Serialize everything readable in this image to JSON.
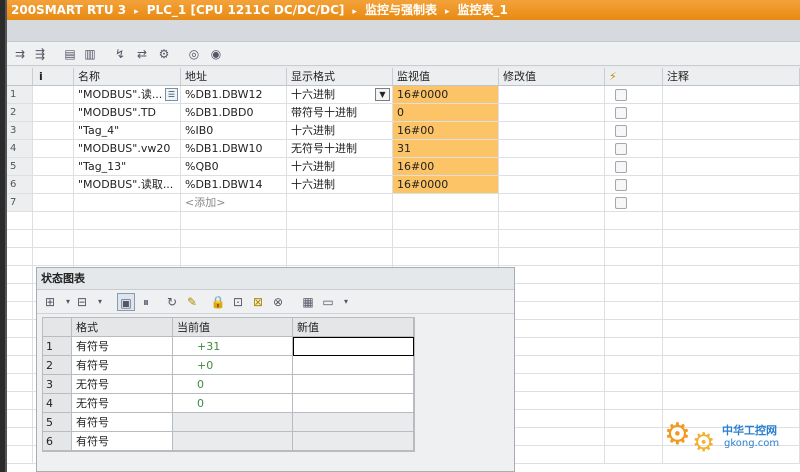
{
  "titlebar": {
    "crumbs": [
      "200SMART RTU 3",
      "PLC_1 [CPU 1211C DC/DC/DC]",
      "监控与强制表",
      "监控表_1"
    ],
    "separator": "▸"
  },
  "toolbar": {
    "icons": [
      "insert-row-icon",
      "add-row-icon",
      "monitor-all-icon",
      "monitor-once-icon",
      "modify-value-icon",
      "modify-now-icon",
      "force-icon",
      "show-hide-icon",
      "glasses-icon"
    ],
    "glyphs": [
      "⇉",
      "⇶",
      "▤",
      "▥",
      "↯",
      "⇄",
      "⚙",
      "◎",
      "◉"
    ]
  },
  "table": {
    "headers": {
      "num": "",
      "info": "i",
      "name": "名称",
      "address": "地址",
      "format": "显示格式",
      "monitor": "监视值",
      "modify": "修改值",
      "force_icon": "lightning-icon",
      "comment": "注释"
    },
    "rows": [
      {
        "num": "1",
        "name": "\"MODBUS\".读...",
        "address": "%DB1.DBW12",
        "format": "十六进制",
        "monitor": "16#0000"
      },
      {
        "num": "2",
        "name": "\"MODBUS\".TD",
        "address": "%DB1.DBD0",
        "format": "带符号十进制",
        "monitor": "0"
      },
      {
        "num": "3",
        "name": "\"Tag_4\"",
        "address": "%IB0",
        "format": "十六进制",
        "monitor": "16#00"
      },
      {
        "num": "4",
        "name": "\"MODBUS\".vw20",
        "address": "%DB1.DBW10",
        "format": "无符号十进制",
        "monitor": "31"
      },
      {
        "num": "5",
        "name": "\"Tag_13\"",
        "address": "%QB0",
        "format": "十六进制",
        "monitor": "16#00"
      },
      {
        "num": "6",
        "name": "\"MODBUS\".读取...",
        "address": "%DB1.DBW14",
        "format": "十六进制",
        "monitor": "16#0000"
      },
      {
        "num": "7",
        "name": "",
        "address": "<添加>",
        "format": "",
        "monitor": ""
      }
    ]
  },
  "status_panel": {
    "title": "状态图表",
    "headers": {
      "num": "",
      "format": "格式",
      "current": "当前值",
      "new": "新值"
    },
    "rows": [
      {
        "num": "1",
        "format": "有符号",
        "current": "+31",
        "new": ""
      },
      {
        "num": "2",
        "format": "有符号",
        "current": "+0",
        "new": ""
      },
      {
        "num": "3",
        "format": "无符号",
        "current": "0",
        "new": ""
      },
      {
        "num": "4",
        "format": "无符号",
        "current": "0",
        "new": ""
      },
      {
        "num": "5",
        "format": "有符号",
        "current": "",
        "new": ""
      },
      {
        "num": "6",
        "format": "有符号",
        "current": "",
        "new": ""
      }
    ]
  },
  "watermark": {
    "brand": "中华工控网",
    "url": "gkong.com"
  },
  "colors": {
    "title_orange": "#e88a12",
    "monitor_orange": "#fcc466",
    "current_value_green": "#3f8a3c"
  }
}
